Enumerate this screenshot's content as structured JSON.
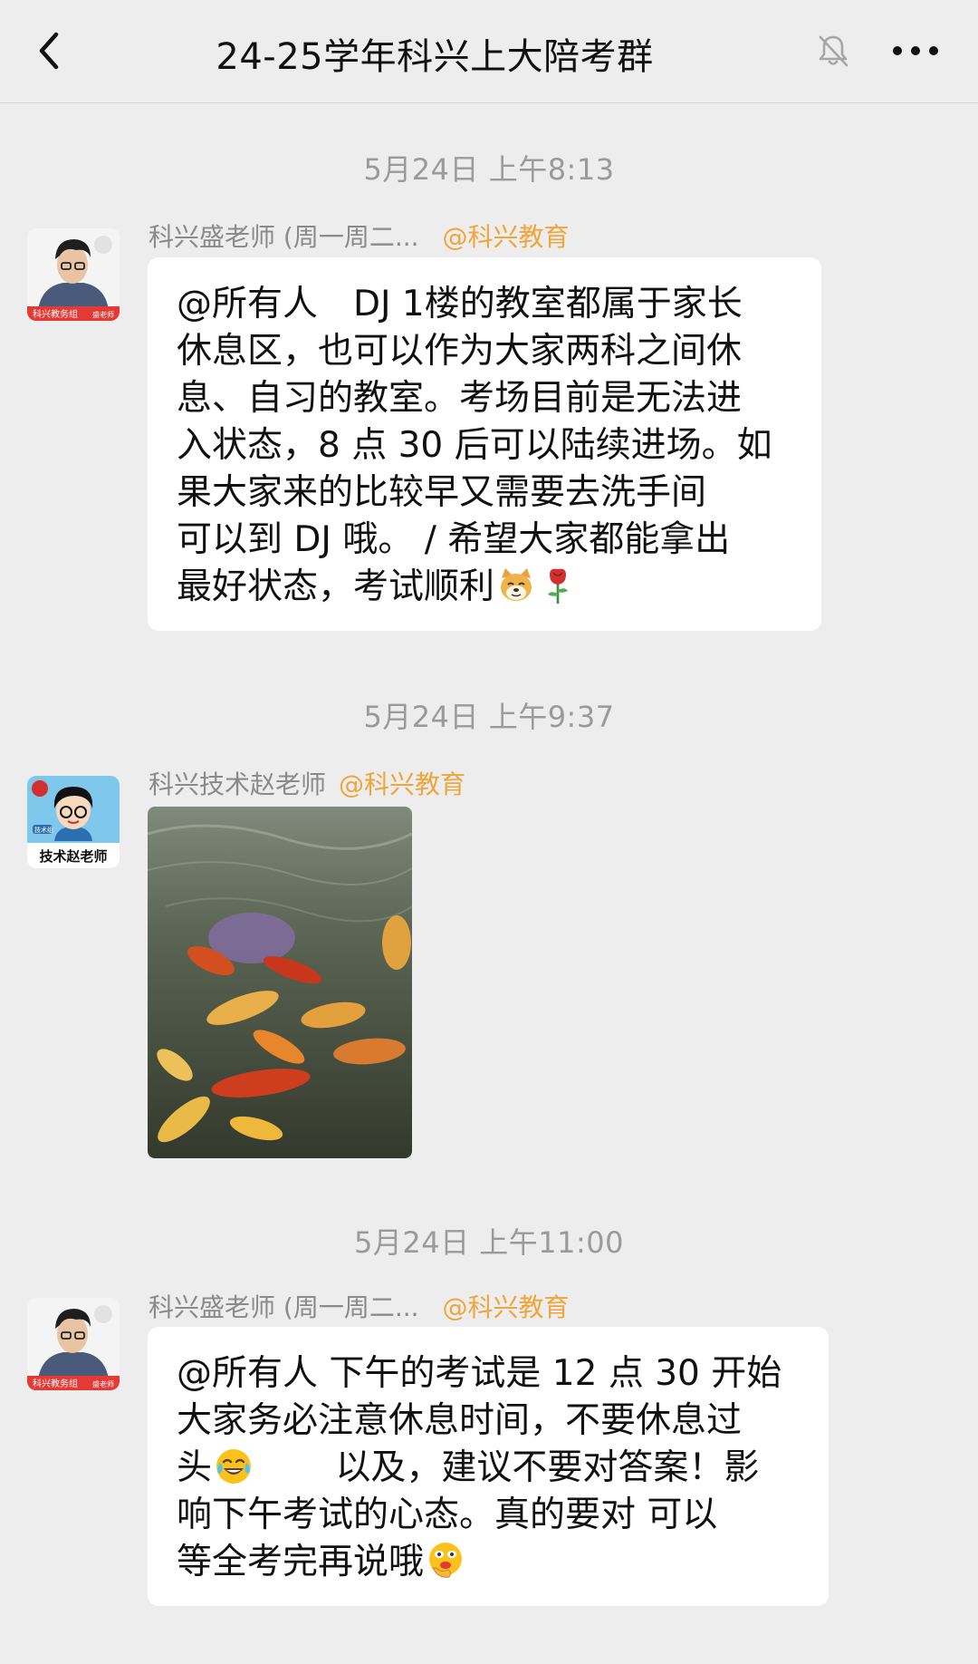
{
  "header": {
    "title": "24-25学年科兴上大陪考群"
  },
  "messages": [
    {
      "timestamp": "5月24日 上午8:13",
      "sender": "科兴盛老师 (周一周二...",
      "tag": "@科兴教育",
      "avatar_caption_left": "科兴教务组",
      "avatar_caption_right": "盛老师",
      "lines": [
        "@所有人　DJ 1楼的教室都属于家长",
        "休息区，也可以作为大家两科之间休",
        "息、自习的教室。考场目前是无法进",
        "入状态，8 点 30 后可以陆续进场。如",
        "果大家来的比较早又需要去洗手间",
        "可以到 DJ 哦。 /  希望大家都能拿出",
        "最好状态，考试顺利"
      ],
      "emojis": [
        "dog-emoji",
        "rose-emoji"
      ]
    },
    {
      "timestamp": "5月24日 上午9:37",
      "sender": "科兴技术赵老师",
      "tag": "@科兴教育",
      "avatar_caption": "技术赵老师",
      "avatar_badge": "技术组",
      "image": "koi-fish-pond-photo"
    },
    {
      "timestamp": "5月24日 上午11:00",
      "sender": "科兴盛老师 (周一周二...",
      "tag": "@科兴教育",
      "avatar_caption_left": "科兴教务组",
      "avatar_caption_right": "盛老师",
      "lines": [
        "@所有人 下午的考试是 12 点 30 开始",
        "大家务必注意休息时间，不要休息过",
        "头",
        "　　 以及，建议不要对答案！影",
        "响下午考试的心态。真的要对  可以",
        "等全考完再说哦"
      ],
      "emojis": [
        "tears-of-joy-emoji",
        "face-with-hand-emoji"
      ]
    }
  ]
}
